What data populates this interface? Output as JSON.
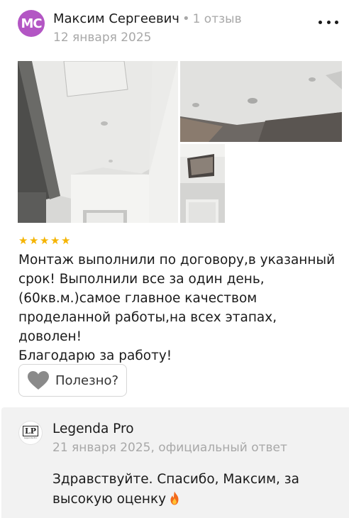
{
  "review": {
    "author": {
      "initials": "МС",
      "name": "Максим Сергеевич",
      "separator": "•",
      "reviews_count": "1 отзыв",
      "avatar_color": "#b356c4"
    },
    "date": "12 января 2025",
    "more_icon": "more-dots-icon",
    "photos": [
      {
        "id": "photo-1"
      },
      {
        "id": "photo-2"
      },
      {
        "id": "photo-3"
      }
    ],
    "rating": 5,
    "rating_max": 5,
    "star_color": "#f5b400",
    "text": "Монтаж выполнили по договору,в указанный\nсрок! Выполнили все за один день,\n(60кв.м.)самое главное качеством\nпроделанной работы,на всех этапах, доволен!\nБлагодарю за работу!",
    "useful": {
      "label": "Полезно?",
      "icon": "heart-icon"
    }
  },
  "reply": {
    "org_name": "Legenda Pro",
    "logo_mark": "LP",
    "logo_caption": "Legenda Pro",
    "meta": "21 января 2025, официальный ответ",
    "text": "Здравствуйте. Спасибо, Максим, за высокую оценку",
    "emoji_icon": "fire-icon",
    "background": "#f2f2f2"
  }
}
